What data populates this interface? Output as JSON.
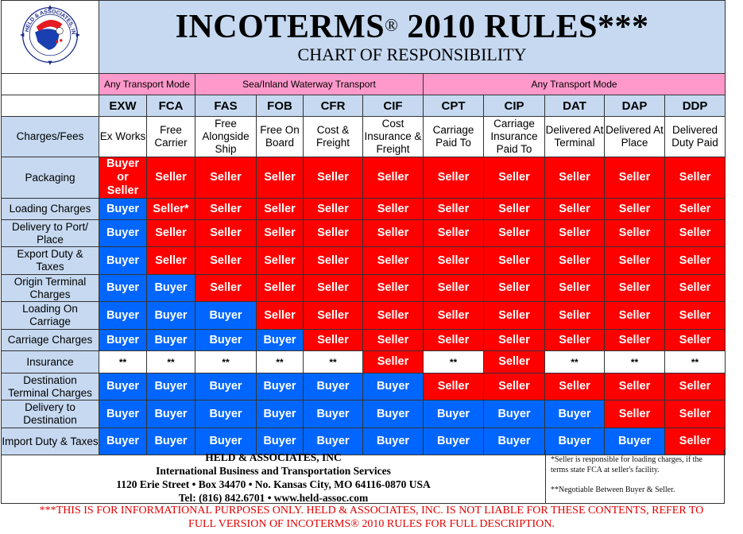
{
  "header": {
    "logo_text": "HELD & ASSOCIATES, INC",
    "title": "INCOTERMS",
    "title_reg": "®",
    "title_rest": " 2010 RULES***",
    "subtitle": "CHART OF RESPONSIBILITY"
  },
  "modes": [
    {
      "label": "Any Transport Mode",
      "span": 2
    },
    {
      "label": "Sea/Inland Waterway Transport",
      "span": 4
    },
    {
      "label": "Any Transport  Mode",
      "span": 5
    }
  ],
  "charges_label": "Charges/Fees",
  "terms": [
    {
      "code": "EXW",
      "name": "Ex Works"
    },
    {
      "code": "FCA",
      "name": "Free Carrier"
    },
    {
      "code": "FAS",
      "name": "Free Alongside Ship"
    },
    {
      "code": "FOB",
      "name": "Free On Board"
    },
    {
      "code": "CFR",
      "name": "Cost & Freight"
    },
    {
      "code": "CIF",
      "name": "Cost Insurance & Freight"
    },
    {
      "code": "CPT",
      "name": "Carriage Paid To"
    },
    {
      "code": "CIP",
      "name": "Carriage Insurance Paid To"
    },
    {
      "code": "DAT",
      "name": "Delivered At Terminal"
    },
    {
      "code": "DAP",
      "name": "Delivered At Place"
    },
    {
      "code": "DDP",
      "name": "Delivered Duty Paid"
    }
  ],
  "rows": [
    {
      "label": "Packaging",
      "cells": [
        "Buyer or Seller",
        "Seller",
        "Seller",
        "Seller",
        "Seller",
        "Seller",
        "Seller",
        "Seller",
        "Seller",
        "Seller",
        "Seller"
      ]
    },
    {
      "label": "Loading Charges",
      "cells": [
        "Buyer",
        "Seller*",
        "Seller",
        "Seller",
        "Seller",
        "Seller",
        "Seller",
        "Seller",
        "Seller",
        "Seller",
        "Seller"
      ]
    },
    {
      "label": "Delivery to Port/ Place",
      "cells": [
        "Buyer",
        "Seller",
        "Seller",
        "Seller",
        "Seller",
        "Seller",
        "Seller",
        "Seller",
        "Seller",
        "Seller",
        "Seller"
      ]
    },
    {
      "label": "Export Duty & Taxes",
      "cells": [
        "Buyer",
        "Seller",
        "Seller",
        "Seller",
        "Seller",
        "Seller",
        "Seller",
        "Seller",
        "Seller",
        "Seller",
        "Seller"
      ]
    },
    {
      "label": "Origin Terminal Charges",
      "cells": [
        "Buyer",
        "Buyer",
        "Seller",
        "Seller",
        "Seller",
        "Seller",
        "Seller",
        "Seller",
        "Seller",
        "Seller",
        "Seller"
      ]
    },
    {
      "label": "Loading On Carriage",
      "cells": [
        "Buyer",
        "Buyer",
        "Buyer",
        "Seller",
        "Seller",
        "Seller",
        "Seller",
        "Seller",
        "Seller",
        "Seller",
        "Seller"
      ]
    },
    {
      "label": "Carriage Charges",
      "cells": [
        "Buyer",
        "Buyer",
        "Buyer",
        "Buyer",
        "Seller",
        "Seller",
        "Seller",
        "Seller",
        "Seller",
        "Seller",
        "Seller"
      ]
    },
    {
      "label": "Insurance",
      "cells": [
        "**",
        "**",
        "**",
        "**",
        "**",
        "Seller",
        "**",
        "Seller",
        "**",
        "**",
        "**"
      ]
    },
    {
      "label": "Destination Terminal Charges",
      "cells": [
        "Buyer",
        "Buyer",
        "Buyer",
        "Buyer",
        "Buyer",
        "Buyer",
        "Seller",
        "Seller",
        "Seller",
        "Seller",
        "Seller"
      ]
    },
    {
      "label": "Delivery to Destination",
      "cells": [
        "Buyer",
        "Buyer",
        "Buyer",
        "Buyer",
        "Buyer",
        "Buyer",
        "Buyer",
        "Buyer",
        "Buyer",
        "Seller",
        "Seller"
      ]
    },
    {
      "label": "Import Duty & Taxes",
      "cells": [
        "Buyer",
        "Buyer",
        "Buyer",
        "Buyer",
        "Buyer",
        "Buyer",
        "Buyer",
        "Buyer",
        "Buyer",
        "Buyer",
        "Seller"
      ]
    }
  ],
  "row_heights": null,
  "footer": {
    "company": "HELD & ASSOCIATES, INC",
    "tagline": "International Business and Transportation Services",
    "address": "1120 Erie Street • Box 34470 • No. Kansas City, MO 64116-0870 USA",
    "contact": "Tel: (816) 842.6701  • www.held-assoc.com",
    "note_seller": "*Seller is responsible for loading charges, if the terms state FCA at seller's facility.",
    "note_negotiable": "**Negotiable Between Buyer & Seller."
  },
  "disclaimer_line1": "***THIS IS FOR INFORMATIONAL PURPOSES ONLY. HELD & ASSOCIATES, INC. IS NOT LIABLE FOR THESE CONTENTS, REFER TO",
  "disclaimer_line2": "FULL VERSION OF INCOTERMS® 2010 RULES FOR FULL DESCRIPTION.",
  "colors": {
    "seller": "#ff0000",
    "buyer": "#0066ff",
    "header_blue": "#c6d9f1",
    "mode_pink": "#ff99cc",
    "disclaimer": "#e00000"
  }
}
